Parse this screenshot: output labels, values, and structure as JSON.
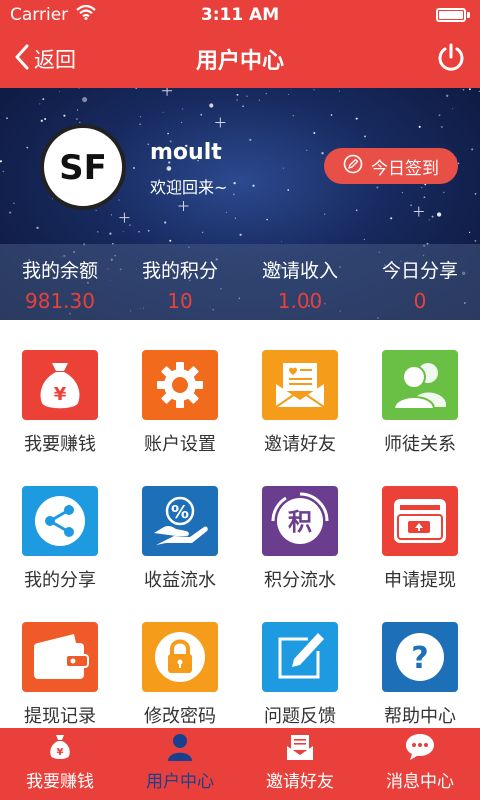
{
  "status_bar": {
    "carrier": "Carrier",
    "time": "3:11 AM",
    "battery_level": 1.0
  },
  "nav": {
    "back_label": "返回",
    "title": "用户中心"
  },
  "profile": {
    "avatar_text": "SF",
    "username": "moult",
    "welcome": "欢迎回来~",
    "checkin_label": "今日签到"
  },
  "stats": [
    {
      "label": "我的余额",
      "value": "981.30"
    },
    {
      "label": "我的积分",
      "value": "10"
    },
    {
      "label": "邀请收入",
      "value": "1.00"
    },
    {
      "label": "今日分享",
      "value": "0"
    }
  ],
  "grid": [
    {
      "label": "我要赚钱",
      "icon": "money-bag-icon",
      "color": "#ec4137"
    },
    {
      "label": "账户设置",
      "icon": "gear-icon",
      "color": "#f26a1b"
    },
    {
      "label": "邀请好友",
      "icon": "invitation-envelope-icon",
      "color": "#f59c1a"
    },
    {
      "label": "师徒关系",
      "icon": "users-icon",
      "color": "#6abf45"
    },
    {
      "label": "我的分享",
      "icon": "share-icon",
      "color": "#1e9ae0"
    },
    {
      "label": "收益流水",
      "icon": "percent-hand-icon",
      "color": "#1d6fb8"
    },
    {
      "label": "积分流水",
      "icon": "points-icon",
      "color": "#6a3d8f"
    },
    {
      "label": "申请提现",
      "icon": "wallet-withdraw-icon",
      "color": "#ec4137"
    },
    {
      "label": "提现记录",
      "icon": "wallet-icon",
      "color": "#f05a28"
    },
    {
      "label": "修改密码",
      "icon": "lock-icon",
      "color": "#f59c1a"
    },
    {
      "label": "问题反馈",
      "icon": "edit-icon",
      "color": "#1e9ae0"
    },
    {
      "label": "帮助中心",
      "icon": "help-icon",
      "color": "#1d6fb8"
    }
  ],
  "tabs": [
    {
      "label": "我要赚钱",
      "icon": "money-bag-icon",
      "active": false
    },
    {
      "label": "用户中心",
      "icon": "user-icon",
      "active": true
    },
    {
      "label": "邀请好友",
      "icon": "invitation-envelope-icon",
      "active": false
    },
    {
      "label": "消息中心",
      "icon": "chat-bubble-icon",
      "active": false
    }
  ],
  "colors": {
    "primary": "#e9403b",
    "stat_value": "#e9403b",
    "active_tab": "#1b3f8f"
  }
}
